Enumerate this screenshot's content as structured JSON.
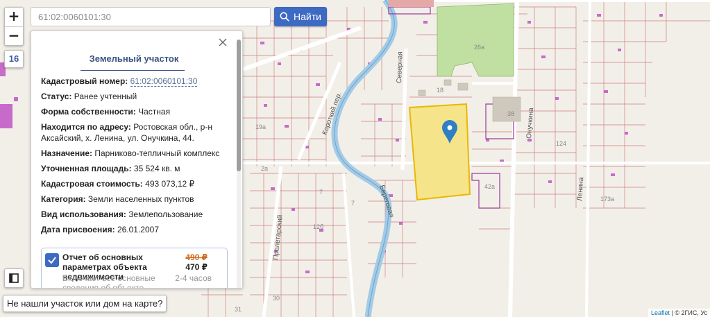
{
  "zoom": {
    "in_label": "+",
    "out_label": "−",
    "level": "16"
  },
  "search": {
    "value": "61:02:0060101:30",
    "button_label": "Найти"
  },
  "panel": {
    "title": "Земельный участок",
    "rows": [
      {
        "label": "Кадастровый номер:",
        "value": "61:02:0060101:30"
      },
      {
        "label": "Статус:",
        "value": "Ранее учтенный"
      },
      {
        "label": "Форма собственности:",
        "value": "Частная"
      },
      {
        "label": "Находится по адресу:",
        "value": "Ростовская обл., р-н Аксайский, х. Ленина, ул. Онучкина, 44."
      },
      {
        "label": "Назначение:",
        "value": "Парниково-тепличный комплекс"
      },
      {
        "label": "Уточненная площадь:",
        "value": "35 524 кв. м"
      },
      {
        "label": "Кадастровая стоимость:",
        "value": "493 073,12 ₽"
      },
      {
        "label": "Категория:",
        "value": "Земли населенных пунктов"
      },
      {
        "label": "Вид использования:",
        "value": "Землепользование"
      },
      {
        "label": "Дата присвоения:",
        "value": "26.01.2007"
      }
    ],
    "report": {
      "title": "Отчет об основных параметрах объекта недвижимости",
      "old_price": "490 ₽",
      "new_price": "470 ₽",
      "description": "Включает все основные сведения об объекте недвижимости в Росреестре",
      "term": "2-4 часов"
    }
  },
  "not_found_label": "Не нашли участок или дом на карте?",
  "attribution": {
    "leaflet": "Leaflet",
    "rest": " | © 2ГИС, Ус"
  },
  "map_labels": {
    "streets": [
      "Северная",
      "Короткий пер.",
      "Береговая",
      "Пролетарский",
      "Онучкина",
      "Ленина"
    ],
    "houses": [
      "26а",
      "38",
      "18",
      "19а",
      "2а",
      "7",
      "12б",
      "7",
      "30",
      "31",
      "42а",
      "124",
      "173а"
    ]
  },
  "colors": {
    "accent": "#3d6ac2",
    "river": "#9ec8e6",
    "parcel": "#f6e48a",
    "green": "#bfe0a0",
    "pin": "#2f7fc4"
  }
}
